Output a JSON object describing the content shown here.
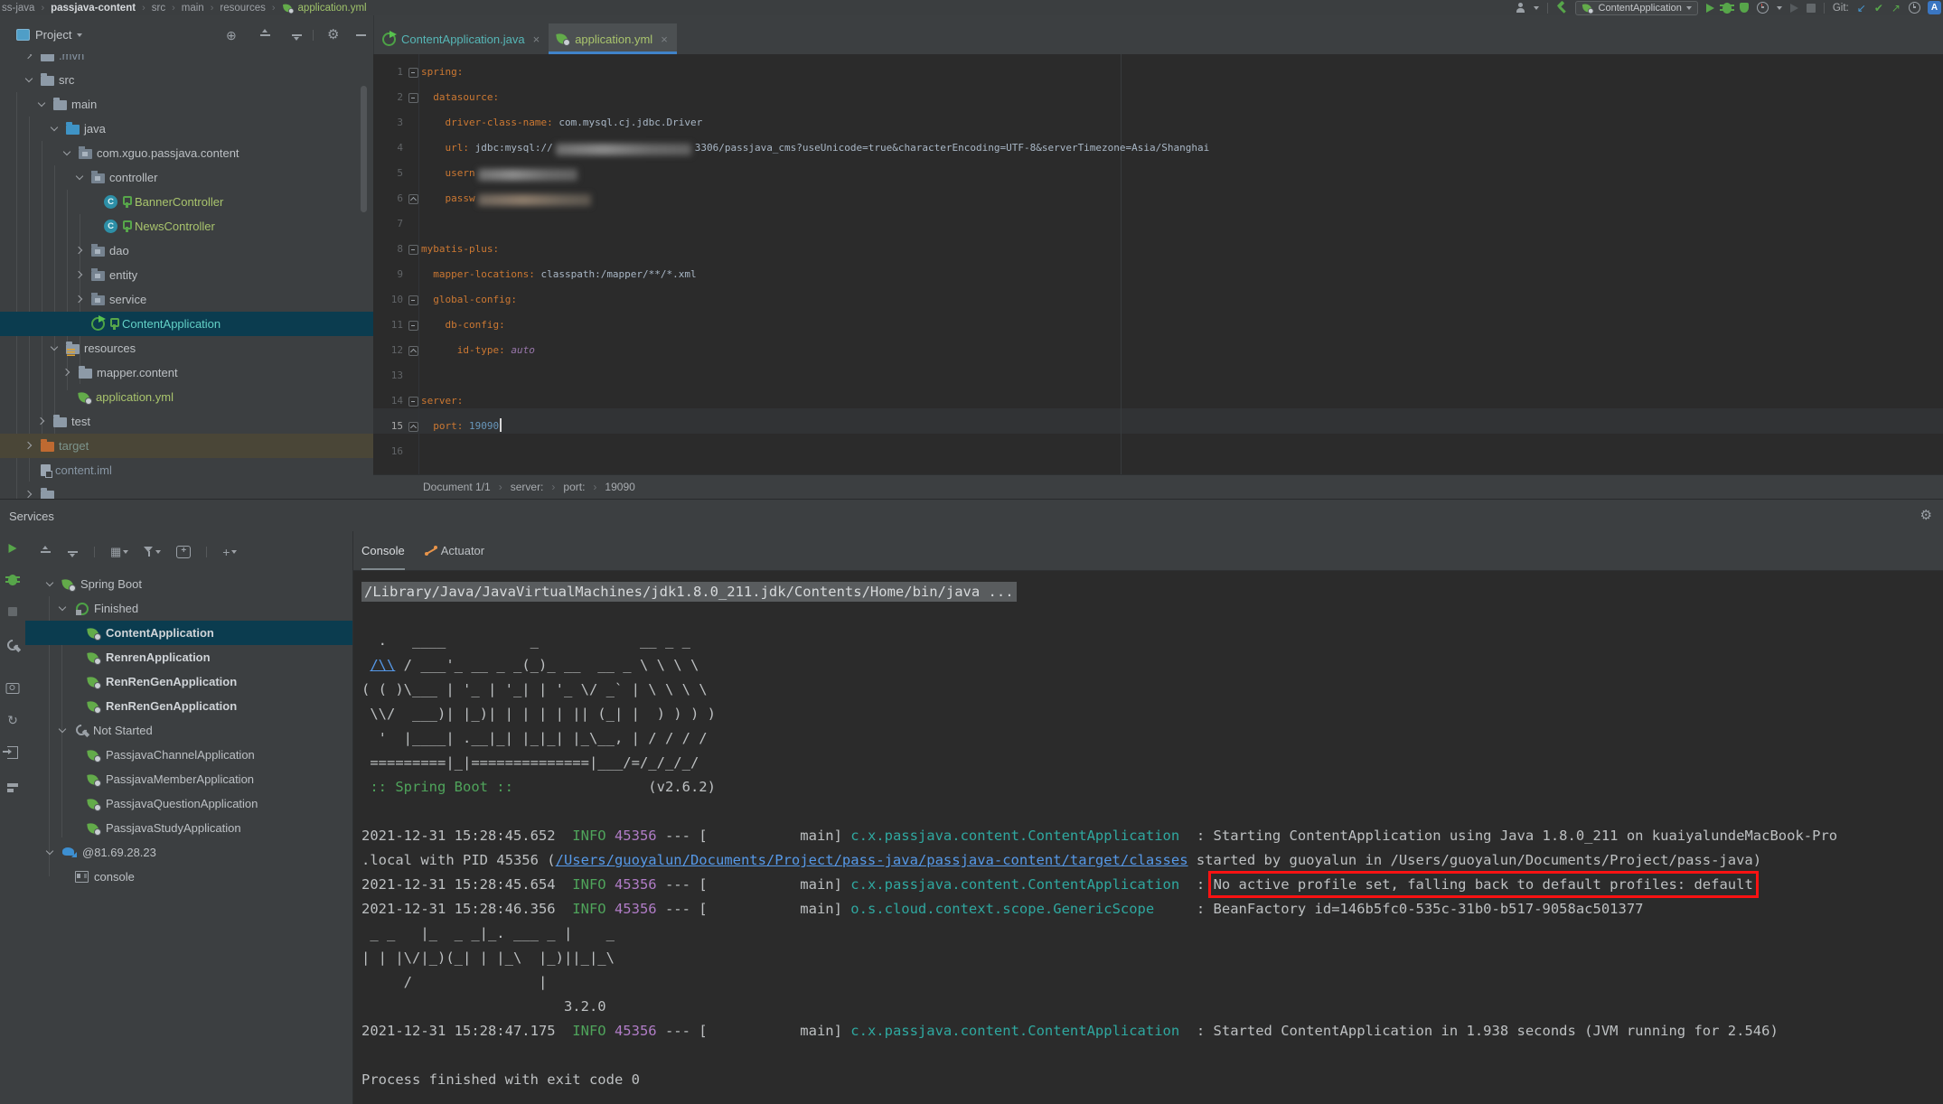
{
  "colors": {
    "accent_blue": "#4083c9",
    "selection": "#0b3c4f",
    "excluded_row": "#4a4637",
    "error_box": "#fd1212",
    "key_orange": "#cc7832",
    "log_teal": "#2fa8a0",
    "info_green": "#4fa45b",
    "link_blue": "#5699e8"
  },
  "topbar": {
    "breadcrumbs": [
      {
        "label": "ss-java"
      },
      {
        "label": "passjava-content",
        "bold": true
      },
      {
        "label": "src"
      },
      {
        "label": "main"
      },
      {
        "label": "resources"
      },
      {
        "label": "application.yml",
        "icon": "leaf",
        "cls": "green"
      }
    ],
    "run_config": "ContentApplication",
    "git_label": "Git:",
    "translate_label": "A"
  },
  "project_panel": {
    "title": "Project",
    "tree": [
      {
        "indent": 1,
        "chev": "closed",
        "icon": "folder",
        "label": ".mvn",
        "cls": "dim"
      },
      {
        "indent": 1,
        "chev": "open",
        "icon": "folder",
        "label": "src"
      },
      {
        "indent": 2,
        "chev": "open",
        "icon": "folder",
        "label": "main"
      },
      {
        "indent": 3,
        "chev": "open",
        "icon": "folder java",
        "label": "java"
      },
      {
        "indent": 4,
        "chev": "open",
        "icon": "pkg",
        "label": "com.xguo.passjava.content"
      },
      {
        "indent": 5,
        "chev": "open",
        "icon": "pkg",
        "label": "controller"
      },
      {
        "indent": 6,
        "chev": "none",
        "icon": "class",
        "key": true,
        "label": "BannerController",
        "cls": "green"
      },
      {
        "indent": 6,
        "chev": "none",
        "icon": "class",
        "key": true,
        "label": "NewsController",
        "cls": "green"
      },
      {
        "indent": 5,
        "chev": "closed",
        "icon": "pkg",
        "label": "dao"
      },
      {
        "indent": 5,
        "chev": "closed",
        "icon": "pkg",
        "label": "entity"
      },
      {
        "indent": 5,
        "chev": "closed",
        "icon": "pkg",
        "label": "service"
      },
      {
        "indent": 5,
        "chev": "none",
        "icon": "sbrun",
        "key": true,
        "label": "ContentApplication",
        "cls": "teal",
        "selected": true
      },
      {
        "indent": 3,
        "chev": "open",
        "icon": "folder res",
        "label": "resources"
      },
      {
        "indent": 4,
        "chev": "closed",
        "icon": "folder",
        "label": "mapper.content"
      },
      {
        "indent": 4,
        "chev": "none",
        "icon": "leaf",
        "label": "application.yml",
        "cls": "green"
      },
      {
        "indent": 2,
        "chev": "closed",
        "icon": "folder",
        "label": "test"
      },
      {
        "indent": 1,
        "chev": "closed",
        "icon": "folder tgt",
        "label": "target",
        "cls": "muted",
        "excluded": true
      },
      {
        "indent": 1,
        "chev": "none",
        "icon": "iml",
        "label": "content.iml",
        "cls": "dim"
      },
      {
        "indent": 1,
        "chev": "closed",
        "icon": "folder",
        "label": "",
        "cls": "dim"
      }
    ]
  },
  "editor": {
    "tabs": [
      {
        "label": "ContentApplication.java",
        "icon": "sbrun",
        "cls": "teal",
        "active": false,
        "close": "×"
      },
      {
        "label": "application.yml",
        "icon": "leaf",
        "cls": "green",
        "active": true,
        "close": "×"
      }
    ],
    "folds": {
      "1": "open",
      "2": "open",
      "6": "close",
      "8": "open",
      "10": "open",
      "11": "open",
      "12": "close",
      "14": "open",
      "15": "close"
    },
    "current_line": 15,
    "code": [
      {
        "n": 1,
        "segs": [
          {
            "t": "spring:",
            "c": "k"
          }
        ]
      },
      {
        "n": 2,
        "segs": [
          {
            "t": "  ",
            "c": "v"
          },
          {
            "t": "datasource:",
            "c": "k"
          }
        ]
      },
      {
        "n": 3,
        "segs": [
          {
            "t": "    ",
            "c": "v"
          },
          {
            "t": "driver-class-name:",
            "c": "k"
          },
          {
            "t": " com.mysql.cj.jdbc.Driver",
            "c": "v"
          }
        ]
      },
      {
        "n": 4,
        "segs": [
          {
            "t": "    ",
            "c": "v"
          },
          {
            "t": "url:",
            "c": "k"
          },
          {
            "t": " jdbc:mysql://",
            "c": "v"
          },
          {
            "blur": 150
          },
          {
            "t": "3306/passjava_cms?useUnicode=true&characterEncoding=UTF-8&serverTimezone=Asia/Shanghai",
            "c": "v"
          }
        ]
      },
      {
        "n": 5,
        "segs": [
          {
            "t": "    ",
            "c": "v"
          },
          {
            "t": "usern",
            "c": "k"
          },
          {
            "blur": 110
          }
        ]
      },
      {
        "n": 6,
        "segs": [
          {
            "t": "    ",
            "c": "v"
          },
          {
            "t": "passw",
            "c": "k"
          },
          {
            "blur": 125,
            "warm": true
          }
        ]
      },
      {
        "n": 7,
        "segs": []
      },
      {
        "n": 8,
        "segs": [
          {
            "t": "mybatis-plus:",
            "c": "k"
          }
        ]
      },
      {
        "n": 9,
        "segs": [
          {
            "t": "  ",
            "c": "v"
          },
          {
            "t": "mapper-locations:",
            "c": "k"
          },
          {
            "t": " classpath:/mapper/**/*.xml",
            "c": "v"
          }
        ]
      },
      {
        "n": 10,
        "segs": [
          {
            "t": "  ",
            "c": "v"
          },
          {
            "t": "global-config:",
            "c": "k"
          }
        ]
      },
      {
        "n": 11,
        "segs": [
          {
            "t": "    ",
            "c": "v"
          },
          {
            "t": "db-config:",
            "c": "k"
          }
        ]
      },
      {
        "n": 12,
        "segs": [
          {
            "t": "      ",
            "c": "v"
          },
          {
            "t": "id-type:",
            "c": "k"
          },
          {
            "t": " ",
            "c": "v"
          },
          {
            "t": "auto",
            "c": "en"
          }
        ]
      },
      {
        "n": 13,
        "segs": []
      },
      {
        "n": 14,
        "segs": [
          {
            "t": "server:",
            "c": "k"
          }
        ]
      },
      {
        "n": 15,
        "segs": [
          {
            "t": "  ",
            "c": "v"
          },
          {
            "t": "port:",
            "c": "k"
          },
          {
            "t": " ",
            "c": "v"
          },
          {
            "t": "19090",
            "c": "num"
          },
          {
            "cursor": true
          }
        ]
      },
      {
        "n": 16,
        "segs": []
      }
    ],
    "breadcrumbs": [
      "Document 1/1",
      "server:",
      "port:",
      "19090"
    ]
  },
  "services": {
    "title": "Services",
    "tabs": [
      {
        "label": "Console",
        "active": true
      },
      {
        "label": "Actuator",
        "icon": "pulse"
      }
    ],
    "tree": [
      {
        "indent": 0,
        "chev": "open",
        "icon": "leaf",
        "label": "Spring Boot"
      },
      {
        "indent": 1,
        "chev": "open",
        "icon": "rerun",
        "label": "Finished"
      },
      {
        "indent": 2,
        "chev": "none",
        "icon": "leaf",
        "label": "ContentApplication",
        "bold": true,
        "selected": true
      },
      {
        "indent": 2,
        "chev": "none",
        "icon": "leaf",
        "label": "RenrenApplication",
        "bold": true
      },
      {
        "indent": 2,
        "chev": "none",
        "icon": "leaf",
        "label": "RenRenGenApplication",
        "bold": true
      },
      {
        "indent": 2,
        "chev": "none",
        "icon": "leaf",
        "label": "RenRenGenApplication",
        "bold": true
      },
      {
        "indent": 1,
        "chev": "open",
        "icon": "wrench",
        "label": "Not Started"
      },
      {
        "indent": 2,
        "chev": "none",
        "icon": "leaf",
        "label": "PassjavaChannelApplication"
      },
      {
        "indent": 2,
        "chev": "none",
        "icon": "leaf",
        "label": "PassjavaMemberApplication"
      },
      {
        "indent": 2,
        "chev": "none",
        "icon": "leaf",
        "label": "PassjavaQuestionApplication"
      },
      {
        "indent": 2,
        "chev": "none",
        "icon": "leaf",
        "label": "PassjavaStudyApplication"
      },
      {
        "indent": 0,
        "chev": "open",
        "icon": "dolphin",
        "label": "@81.69.28.23"
      },
      {
        "indent": 1,
        "chev": "none",
        "icon": "dbconsole",
        "label": "console"
      }
    ],
    "console": {
      "lines": [
        {
          "segs": [
            {
              "t": "/Library/Java/JavaVirtualMachines/jdk1.8.0_211.jdk/Contents/Home/bin/java ...",
              "c": "cmd"
            }
          ]
        },
        {
          "segs": []
        },
        {
          "segs": [
            {
              "t": "  .   ____          _            __ _ _"
            }
          ]
        },
        {
          "segs": [
            {
              "t": " "
            },
            {
              "t": "/\\\\",
              "c": "link"
            },
            {
              "t": " / ___'_ __ _ _(_)_ __  __ _ \\ \\ \\ \\"
            }
          ]
        },
        {
          "segs": [
            {
              "t": "( ( )\\___ | '_ | '_| | '_ \\/ _` | \\ \\ \\ \\"
            }
          ]
        },
        {
          "segs": [
            {
              "t": " \\\\/  ___)| |_)| | | | | || (_| |  ) ) ) )"
            }
          ]
        },
        {
          "segs": [
            {
              "t": "  '  |____| .__|_| |_|_| |_\\__, | / / / /"
            }
          ]
        },
        {
          "segs": [
            {
              "t": " =========|_|==============|___/=/_/_/_/"
            }
          ]
        },
        {
          "segs": [
            {
              "t": " :: Spring Boot ::",
              "c": "grn"
            },
            {
              "t": "                (v2.6.2)"
            }
          ]
        },
        {
          "segs": []
        },
        {
          "segs": [
            {
              "t": "2021-12-31 15:28:45.652  "
            },
            {
              "t": "INFO",
              "c": "info"
            },
            {
              "t": " "
            },
            {
              "t": "45356",
              "c": "pid"
            },
            {
              "t": " --- [           main] "
            },
            {
              "t": "c.x.passjava.content.ContentApplication",
              "c": "log"
            },
            {
              "t": "  : Starting ContentApplication using Java 1.8.0_211 on kuaiyalundeMacBook-Pro"
            }
          ]
        },
        {
          "segs": [
            {
              "t": ".local with PID 45356 ("
            },
            {
              "t": "/Users/guoyalun/Documents/Project/pass-java/passjava-content/target/classes",
              "c": "link"
            },
            {
              "t": " started by guoyalun in /Users/guoyalun/Documents/Project/pass-java)"
            }
          ]
        },
        {
          "segs": [
            {
              "t": "2021-12-31 15:28:45.654  "
            },
            {
              "t": "INFO",
              "c": "info"
            },
            {
              "t": " "
            },
            {
              "t": "45356",
              "c": "pid"
            },
            {
              "t": " --- [           main] "
            },
            {
              "t": "c.x.passjava.content.ContentApplication",
              "c": "log"
            },
            {
              "t": "  : "
            },
            {
              "t": "No active profile set, falling back to default profiles: default",
              "box": true
            }
          ]
        },
        {
          "segs": [
            {
              "t": "2021-12-31 15:28:46.356  "
            },
            {
              "t": "INFO",
              "c": "info"
            },
            {
              "t": " "
            },
            {
              "t": "45356",
              "c": "pid"
            },
            {
              "t": " --- [           main] "
            },
            {
              "t": "o.s.cloud.context.scope.GenericScope",
              "c": "log"
            },
            {
              "t": "     : BeanFactory id=146b5f​c0-535c-31b0-b517-9058ac501377"
            }
          ]
        },
        {
          "segs": [
            {
              "t": " _ _   |_  _ _|_. ___ _ |    _ "
            }
          ]
        },
        {
          "segs": [
            {
              "t": "| | |\\/|_)(_| | |_\\  |_)||_|_\\"
            }
          ]
        },
        {
          "segs": [
            {
              "t": "     /               |"
            }
          ]
        },
        {
          "segs": [
            {
              "t": "                        3.2.0"
            }
          ]
        },
        {
          "segs": [
            {
              "t": "2021-12-31 15:28:47.175  "
            },
            {
              "t": "INFO",
              "c": "info"
            },
            {
              "t": " "
            },
            {
              "t": "45356",
              "c": "pid"
            },
            {
              "t": " --- [           main] "
            },
            {
              "t": "c.x.passjava.content.ContentApplication",
              "c": "log"
            },
            {
              "t": "  : Started ContentApplication in 1.938 seconds (JVM running for 2.546)"
            }
          ]
        },
        {
          "segs": []
        },
        {
          "segs": [
            {
              "t": "Process finished with exit code 0"
            }
          ]
        }
      ]
    }
  }
}
